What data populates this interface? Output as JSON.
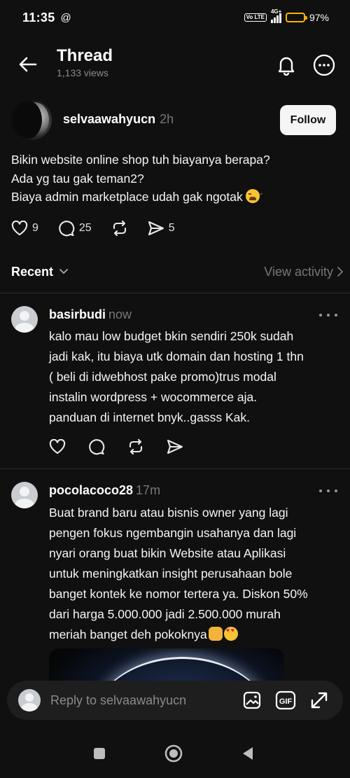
{
  "status": {
    "time": "11:35",
    "app_glyph": "@",
    "network": "4G+",
    "volte": "Vo LTE",
    "battery": "97%"
  },
  "header": {
    "title": "Thread",
    "views": "1,133 views"
  },
  "post": {
    "username": "selvaawahyucn",
    "time": "2h",
    "follow_label": "Follow",
    "lines": [
      "Bikin website online shop tuh biayanya berapa?",
      "Ada yg tau gak teman2?",
      "Biaya admin marketplace udah gak ngotak"
    ],
    "likes": "9",
    "comments": "25",
    "shares": "5"
  },
  "recent": {
    "label": "Recent",
    "view_activity": "View activity"
  },
  "replies": [
    {
      "username": "basirbudi",
      "time": "now",
      "lines": [
        "kalo mau low budget bkin sendiri 250k sudah",
        "jadi kak, itu biaya utk domain dan hosting 1 thn",
        "( beli di idwebhost pake promo)trus modal",
        "instalin wordpress + wocommerce aja.",
        "panduan di internet bnyk..gasss Kak."
      ]
    },
    {
      "username": "pocolacoco28",
      "time": "17m",
      "lines": [
        "Buat brand baru atau bisnis owner yang lagi",
        "pengen fokus ngembangin usahanya dan lagi",
        "nyari orang buat bikin Website atau Aplikasi",
        "untuk meningkatkan insight perusahaan bole",
        "banget kontek ke nomor tertera ya. Diskon 50%",
        "dari harga 5.000.000 jadi 2.500.000 murah",
        "meriah banget deh pokoknya"
      ]
    }
  ],
  "composer": {
    "placeholder": "Reply to selvaawahyucn",
    "gif_label": "GIF"
  },
  "colors": {
    "background": "#101010",
    "text": "#f3f5f7",
    "muted": "#777777",
    "battery": "#f5b400"
  }
}
